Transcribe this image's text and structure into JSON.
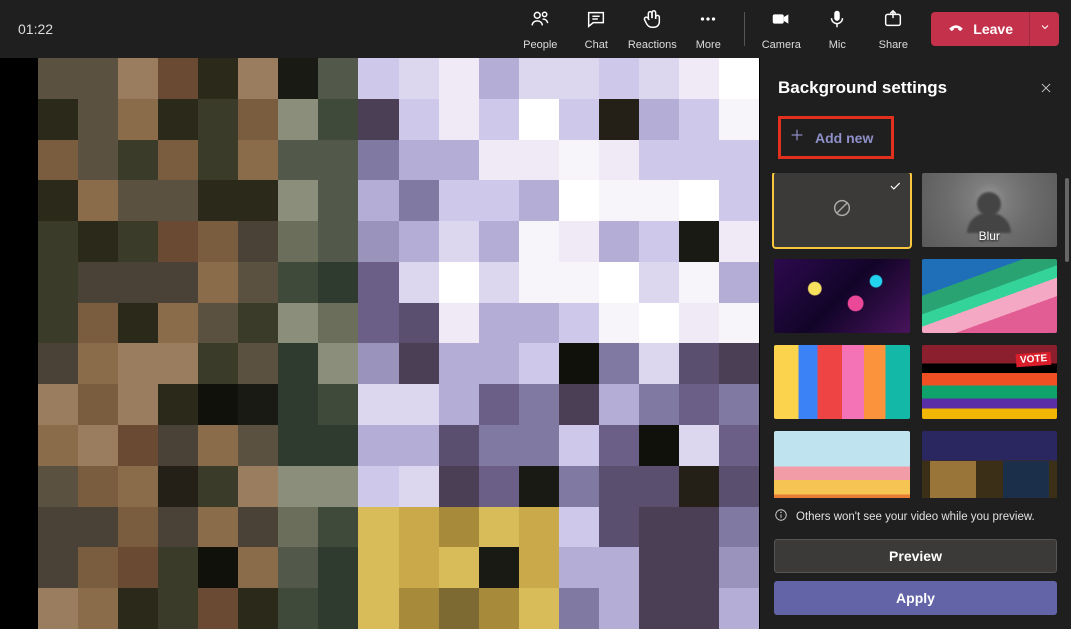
{
  "timer": "01:22",
  "toolbar": {
    "people": "People",
    "chat": "Chat",
    "reactions": "Reactions",
    "more": "More",
    "camera": "Camera",
    "mic": "Mic",
    "share": "Share"
  },
  "leave": {
    "label": "Leave"
  },
  "panel": {
    "title": "Background settings",
    "add_new": "Add new",
    "blur_label": "Blur",
    "info": "Others won't see your video while you preview.",
    "preview": "Preview",
    "apply": "Apply"
  }
}
